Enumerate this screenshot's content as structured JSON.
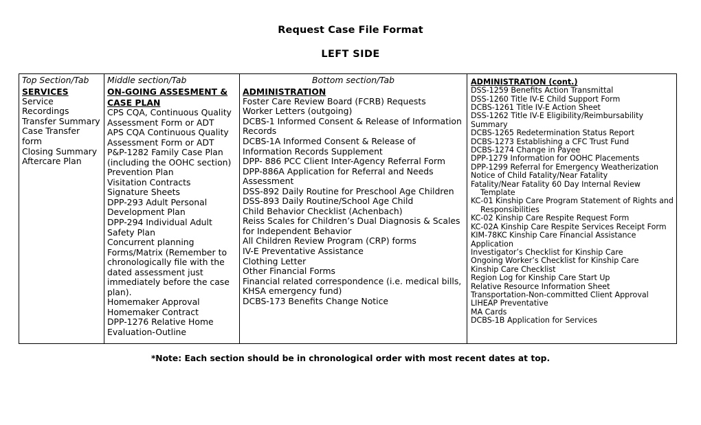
{
  "document": {
    "title": "Request Case File Format",
    "subtitle": "LEFT SIDE",
    "footnote": "*Note: Each section should be in chronological order with most recent dates at top."
  },
  "table": {
    "columns": [
      {
        "id": "top-section",
        "tab_label": "Top Section/Tab",
        "tab_align": "left",
        "heading": "SERVICES",
        "items": [
          {
            "text": "Service Recordings",
            "indent": false
          },
          {
            "text": "Transfer Summary",
            "indent": false
          },
          {
            "text": "Case Transfer form",
            "indent": false
          },
          {
            "text": "Closing Summary",
            "indent": false
          },
          {
            "text": "Aftercare Plan",
            "indent": false
          }
        ]
      },
      {
        "id": "middle-section",
        "tab_label": "Middle section/Tab",
        "tab_align": "left",
        "heading": "ON-GOING ASSESMENT & CASE  PLAN",
        "items": [
          {
            "text": "CPS CQA, Continuous Quality Assessment Form or ADT",
            "indent": false
          },
          {
            "text": "APS CQA Continuous Quality Assessment Form or ADT",
            "indent": false
          },
          {
            "text": "P&P-1282 Family Case Plan (including the OOHC section)",
            "indent": false
          },
          {
            "text": "Prevention Plan",
            "indent": false
          },
          {
            "text": "Visitation Contracts",
            "indent": false
          },
          {
            "text": "Signature Sheets",
            "indent": false
          },
          {
            "text": "DPP-293 Adult Personal Development Plan",
            "indent": false
          },
          {
            "text": "DPP-294 Individual Adult Safety Plan",
            "indent": false
          },
          {
            "text": "Concurrent planning Forms/Matrix (Remember to chronologically file with the dated assessment just immediately before the case plan).",
            "indent": false
          },
          {
            "text": "Homemaker Approval",
            "indent": false
          },
          {
            "text": "Homemaker Contract",
            "indent": false
          },
          {
            "text": "DPP-1276 Relative Home Evaluation-Outline",
            "indent": false
          }
        ]
      },
      {
        "id": "bottom-section",
        "tab_label": "Bottom section/Tab",
        "tab_align": "center",
        "heading": "ADMINISTRATION",
        "items": [
          {
            "text": "Foster Care Review Board (FCRB) Requests",
            "indent": false
          },
          {
            "text": "Worker Letters (outgoing)",
            "indent": false
          },
          {
            "text": "DCBS-1 Informed Consent & Release of Information Records",
            "indent": false
          },
          {
            "text": "DCBS-1A Informed Consent & Release of Information Records Supplement",
            "indent": false
          },
          {
            "text": "DPP- 886 PCC Client Inter-Agency Referral Form",
            "indent": false
          },
          {
            "text": "DPP-886A Application for Referral and Needs Assessment",
            "indent": false
          },
          {
            "text": "DSS-892 Daily Routine for Preschool Age Children",
            "indent": false
          },
          {
            "text": "DSS-893 Daily Routine/School Age Child",
            "indent": false
          },
          {
            "text": "Child Behavior Checklist (Achenbach)",
            "indent": false
          },
          {
            "text": "Reiss Scales for Children’s Dual Diagnosis & Scales for Independent Behavior",
            "indent": false
          },
          {
            "text": "All Children Review Program (CRP) forms",
            "indent": false
          },
          {
            "text": "IV-E Preventative Assistance",
            "indent": false
          },
          {
            "text": "Clothing Letter",
            "indent": false
          },
          {
            "text": "Other Financial Forms",
            "indent": false
          },
          {
            "text": "Financial related correspondence (i.e. medical bills, KHSA emergency fund)",
            "indent": false
          },
          {
            "text": "DCBS-173 Benefits Change Notice",
            "indent": false
          }
        ]
      },
      {
        "id": "administration-cont",
        "tab_label": "",
        "tab_align": "left",
        "heading": "ADMINISTRATION (cont.)",
        "items": [
          {
            "text": "DSS-1259 Benefits Action Transmittal",
            "indent": false
          },
          {
            "text": "DSS-1260 Title IV-E Child Support Form",
            "indent": false
          },
          {
            "text": "DCBS-1261 Title IV-E Action Sheet",
            "indent": false
          },
          {
            "text": "DSS-1262 Title IV-E Eligibility/Reimbursability Summary",
            "indent": false
          },
          {
            "text": "DCBS-1265 Redetermination Status Report",
            "indent": false
          },
          {
            "text": "DCBS-1273 Establishing a CFC Trust Fund",
            "indent": false
          },
          {
            "text": "DCBS-1274 Change in Payee",
            "indent": false
          },
          {
            "text": "DPP-1279 Information for OOHC Placements",
            "indent": false
          },
          {
            "text": "DPP-1299 Referral for Emergency Weatherization",
            "indent": false
          },
          {
            "text": "Notice of Child Fatality/Near Fatality",
            "indent": false
          },
          {
            "text": "Fatality/Near Fatality 60 Day Internal Review",
            "indent": false
          },
          {
            "text": "Template",
            "indent": true
          },
          {
            "text": "KC-01 Kinship Care Program Statement of Rights and",
            "indent": false
          },
          {
            "text": "Responsibilities",
            "indent": true
          },
          {
            "text": "KC-02 Kinship Care Respite Request Form",
            "indent": false
          },
          {
            "text": "KC-02A Kinship Care Respite Services Receipt Form",
            "indent": false
          },
          {
            "text": "KIM-78KC Kinship Care Financial Assistance Application",
            "indent": false
          },
          {
            "text": "Investigator’s Checklist for Kinship Care",
            "indent": false
          },
          {
            "text": "Ongoing Worker’s Checklist for Kinship Care",
            "indent": false
          },
          {
            "text": "Kinship Care Checklist",
            "indent": false
          },
          {
            "text": "Region Log for Kinship Care Start Up",
            "indent": false
          },
          {
            "text": "Relative Resource Information Sheet",
            "indent": false
          },
          {
            "text": "Transportation-Non-committed Client Approval",
            "indent": false
          },
          {
            "text": "LIHEAP Preventative",
            "indent": false
          },
          {
            "text": "MA Cards",
            "indent": false
          },
          {
            "text": "DCBS-1B Application for Services",
            "indent": false
          }
        ]
      }
    ]
  }
}
